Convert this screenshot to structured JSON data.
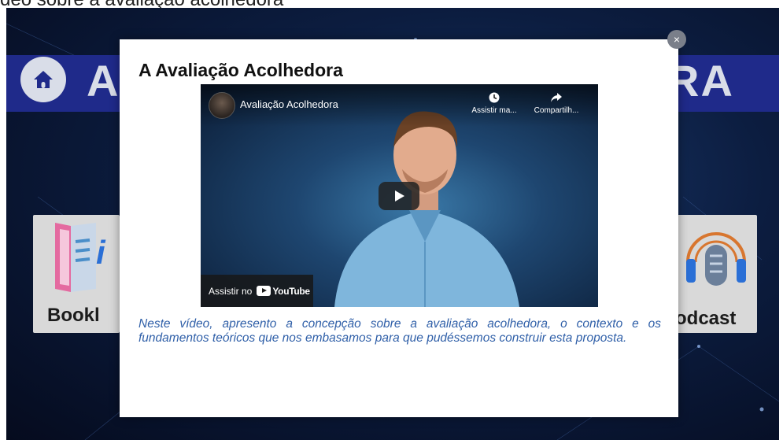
{
  "top_caption": "deo sobre a avaliação acolhedora",
  "background_slide": {
    "banner_title_left": "A",
    "banner_title_right": "RA",
    "cards": [
      {
        "label": "Bookl"
      },
      {
        "label": "odcast"
      }
    ]
  },
  "modal": {
    "title": "A Avaliação Acolhedora",
    "close_label": "×",
    "video": {
      "title": "Avaliação Acolhedora",
      "action_watch_later": "Assistir ma...",
      "action_share": "Compartilh...",
      "watch_on_label": "Assistir no",
      "youtube_label": "YouTube"
    },
    "description": "Neste vídeo, apresento a concepção sobre a avaliação acolhedora, o contexto e os fundamentos teóricos que nos embasamos para que pudéssemos construir esta proposta."
  },
  "colors": {
    "banner": "#1f2a8a",
    "description_text": "#2f5fa8",
    "modal_bg": "#ffffff"
  }
}
